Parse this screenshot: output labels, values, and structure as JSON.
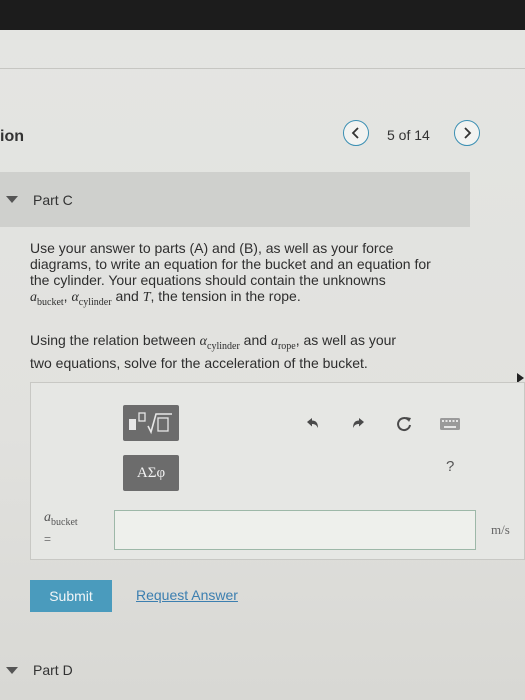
{
  "header": {
    "section_title": "ion",
    "page_count": "5 of 14"
  },
  "part_c": {
    "label": "Part C",
    "paragraph1": {
      "line1": "Use your answer to parts (A) and (B), as well as your force",
      "line2": "diagrams, to write an equation for the bucket and an equation for",
      "line3": "the cylinder. Your equations should contain the unknowns",
      "a": "a",
      "bucket_sub": "bucket",
      "alpha": "α",
      "cylinder_sub": "cylinder",
      "and": " and ",
      "T": "T",
      "tail": ", the tension in the rope."
    },
    "paragraph2": {
      "pre": "Using the relation between ",
      "alpha": "α",
      "cylinder_sub": "cylinder",
      "and": " and ",
      "a": "a",
      "rope_sub": "rope",
      "post": ", as well as your",
      "line2": "two equations, solve for the acceleration of the bucket."
    }
  },
  "toolbar": {
    "symbols_label": "ΑΣφ",
    "help_label": "?"
  },
  "answer": {
    "var_a": "a",
    "var_sub": "bucket",
    "equals": "=",
    "value": "",
    "unit": "m/s"
  },
  "actions": {
    "submit_label": "Submit",
    "request_label": "Request Answer"
  },
  "part_d": {
    "label": "Part D"
  }
}
